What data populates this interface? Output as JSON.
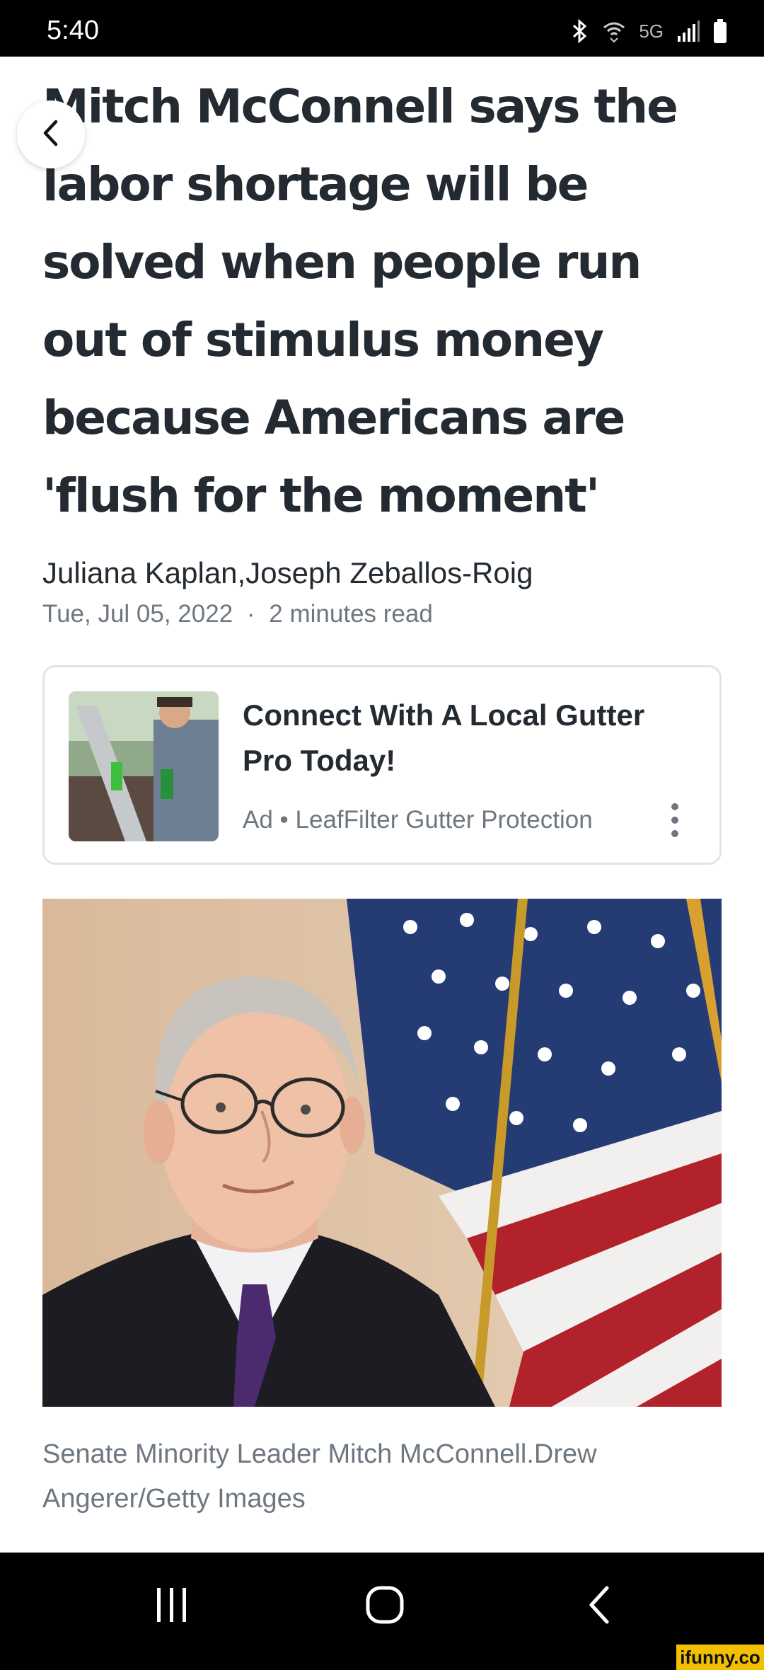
{
  "status_bar": {
    "time": "5:40",
    "network": "5G",
    "icons": [
      "bluetooth-icon",
      "wifi-icon",
      "signal-icon",
      "battery-icon"
    ]
  },
  "article": {
    "headline_lines": [
      "Mitch McConnell says the",
      "labor shortage will be",
      "solved when people run",
      "out of stimulus money",
      "because Americans are",
      "'flush for the moment'"
    ],
    "byline": "Juliana Kaplan,Joseph Zeballos-Roig",
    "date": "Tue, Jul 05, 2022",
    "separator": "·",
    "read_time": "2 minutes read",
    "caption_lines": [
      "Senate Minority Leader Mitch McConnell.Drew",
      "Angerer/Getty Images"
    ]
  },
  "ad": {
    "title_lines": [
      "Connect With A Local Gutter",
      "Pro Today!"
    ],
    "source": "Ad • LeafFilter Gutter Protection"
  },
  "watermark": "ifunny.co",
  "colors": {
    "headline": "#232a31",
    "secondary_text": "#6e7780",
    "card_border": "#e0e4e9",
    "watermark_bg": "#f2c000"
  }
}
